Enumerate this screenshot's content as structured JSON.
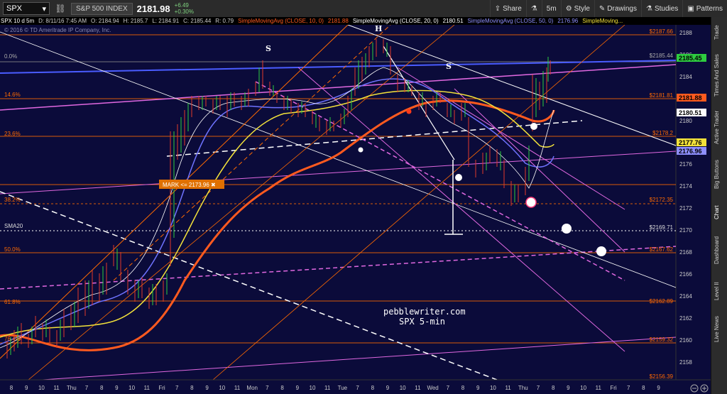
{
  "toolbar": {
    "symbol": "SPX",
    "index_name": "S&P 500 INDEX",
    "last_price": "2181.98",
    "change": "+6.49",
    "change_pct": "+0.30%",
    "buttons": {
      "share": "Share",
      "studies_icon": "",
      "interval": "5m",
      "style": "Style",
      "drawings": "Drawings",
      "studies": "Studies",
      "patterns": "Patterns"
    }
  },
  "infobar": {
    "period": "SPX 10 d 5m",
    "datetime": "D: 8/11/16 7:45 AM",
    "open": "O: 2184.94",
    "high": "H: 2185.7",
    "low": "L: 2184.91",
    "close": "C: 2185.44",
    "r": "R: 0.79",
    "sma10_label": "SimpleMovingAvg (CLOSE, 10, 0)",
    "sma10_value": "2181.88",
    "sma20_label": "SimpleMovingAvg (CLOSE, 20, 0)",
    "sma20_value": "2180.51",
    "sma50_label": "SimpleMovingAvg (CLOSE, 50, 0)",
    "sma50_value": "2176.96",
    "sma_extra_label": "SimpleMoving..."
  },
  "chart": {
    "copyright": "© 2016 © TD Ameritrade IP Company, Inc.",
    "watermark_line1": "pebblewriter.com",
    "watermark_line2": "SPX 5-min",
    "mark_label": "MARK <= 2173.96 ✖",
    "sma20_tag": "SMA20",
    "pattern_labels": {
      "left_s": "S",
      "head": "H",
      "right_s": "S"
    },
    "fib_left_labels": [
      "0.0%",
      "14.6%",
      "23.6%",
      "38.2%",
      "50.0%",
      "61.8%",
      "76.4%"
    ],
    "fib_right_values": [
      "$2187.66",
      "$2185.44",
      "$2181.81",
      "$2178.2",
      "$2172.35",
      "$2169.71",
      "$2167.62",
      "$2162.89",
      "$2159.32",
      "$2156.39"
    ],
    "price_axis": [
      "2188",
      "2186",
      "2184",
      "2182",
      "2180",
      "2178",
      "2176",
      "2174",
      "2172",
      "2170",
      "2168",
      "2166",
      "2164",
      "2162",
      "2160",
      "2158"
    ],
    "price_tags": {
      "last": "2185.45",
      "sma10": "2181.88",
      "sma20": "2180.51",
      "sma_yellow": "2177.76",
      "sma50": "2176.96"
    },
    "time_axis": [
      "8",
      "9",
      "10",
      "11",
      "Thu",
      "7",
      "8",
      "9",
      "10",
      "11",
      "Fri",
      "7",
      "8",
      "9",
      "10",
      "11",
      "Mon",
      "7",
      "8",
      "9",
      "10",
      "11",
      "Tue",
      "7",
      "8",
      "9",
      "10",
      "11",
      "Wed",
      "7",
      "8",
      "9",
      "10",
      "11",
      "Thu",
      "7",
      "8",
      "9",
      "10",
      "11",
      "Fri",
      "7",
      "8",
      "9",
      "10"
    ],
    "colors": {
      "background": "#0b0b3a",
      "up": "#2ecc40",
      "down": "#e0392b",
      "sma_orange": "#ff5a1f",
      "sma_yellow": "#f2e13a",
      "sma_blue": "#6f73ff",
      "fib": "#ff6a00"
    }
  },
  "sidebar": {
    "tabs": [
      "Trade",
      "Times And Sales",
      "Active Trader",
      "Big Buttons",
      "Chart",
      "Dashboard",
      "Level II",
      "Live News"
    ]
  },
  "bottom": {
    "zoom_icons": [
      "zoom-out",
      "zoom-in"
    ]
  }
}
